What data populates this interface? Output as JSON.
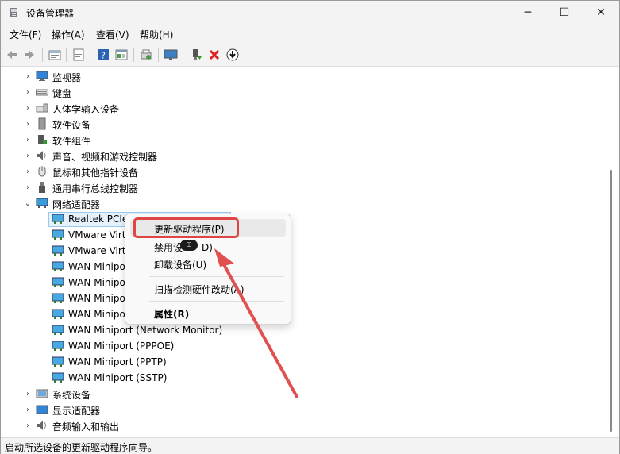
{
  "window": {
    "title": "设备管理器",
    "controls": {
      "minimize": "─",
      "maximize": "☐",
      "close": "✕"
    }
  },
  "menu": {
    "items": [
      "文件(F)",
      "操作(A)",
      "查看(V)",
      "帮助(H)"
    ]
  },
  "toolbar": {
    "icons": [
      "back-icon",
      "forward-icon",
      "properties-icon",
      "driver-icon",
      "help-icon",
      "show-hidden-icon",
      "scan-icon",
      "monitor-icon",
      "enable-device-icon",
      "uninstall-icon",
      "update-driver-icon"
    ]
  },
  "tree": {
    "categories_top": [
      {
        "label": "监视器",
        "icon": "monitor-icon"
      },
      {
        "label": "键盘",
        "icon": "keyboard-icon"
      },
      {
        "label": "人体学输入设备",
        "icon": "hid-icon"
      },
      {
        "label": "软件设备",
        "icon": "software-device-icon"
      },
      {
        "label": "软件组件",
        "icon": "software-component-icon"
      },
      {
        "label": "声音、视频和游戏控制器",
        "icon": "speaker-icon"
      },
      {
        "label": "鼠标和其他指针设备",
        "icon": "mouse-icon"
      },
      {
        "label": "通用串行总线控制器",
        "icon": "usb-icon"
      }
    ],
    "network": {
      "label": "网络适配器",
      "children": [
        "Realtek PCIe GbE Family Controller",
        "VMware Virtual Ethernet Adapter for VMnet1",
        "VMware Virtual Ethernet Adapter for VMnet8",
        "WAN Miniport (IKEv2)",
        "WAN Miniport (IP)",
        "WAN Miniport (IPv6)",
        "WAN Miniport (L2TP)",
        "WAN Miniport (Network Monitor)",
        "WAN Miniport (PPPOE)",
        "WAN Miniport (PPTP)",
        "WAN Miniport (SSTP)"
      ],
      "visible_children": [
        "Realtek PCIe Gl",
        "VMware Virt",
        "VMware Virt",
        "WAN Minipor",
        "WAN Minipor",
        "WAN Minipor",
        "WAN Minipor",
        "WAN Miniport (Network Monitor)",
        "WAN Miniport (PPPOE)",
        "WAN Miniport (PPTP)",
        "WAN Miniport (SSTP)"
      ]
    },
    "categories_bottom": [
      {
        "label": "系统设备",
        "icon": "system-device-icon"
      },
      {
        "label": "显示适配器",
        "icon": "display-adapter-icon"
      },
      {
        "label": "音频输入和输出",
        "icon": "audio-io-icon"
      }
    ]
  },
  "context_menu": {
    "update_driver": "更新驱动程序(P)",
    "disable_device_prefix": "禁用设",
    "disable_device_suffix": "D)",
    "uninstall_device": "卸载设备(U)",
    "scan_hardware": "扫描检测硬件改动(A)",
    "properties": "属性(R)"
  },
  "status": {
    "text": "启动所选设备的更新驱动程序向导。"
  },
  "colors": {
    "highlight": "#e04545",
    "selection": "#e5f1fb",
    "accent": "#0067c0"
  }
}
